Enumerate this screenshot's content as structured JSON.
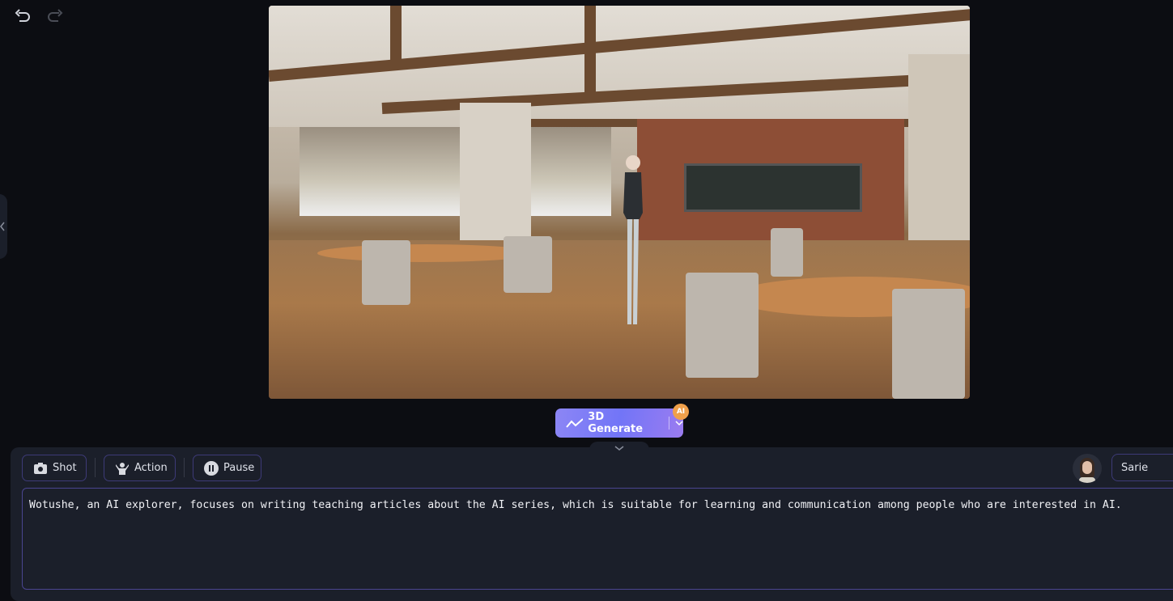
{
  "toolbar_top": {
    "undo_icon": "undo-icon",
    "redo_icon": "redo-icon"
  },
  "generate": {
    "label": "3D Generate",
    "badge": "AI",
    "accent": "#7a78f6"
  },
  "controls": {
    "shot": "Shot",
    "action": "Action",
    "pause": "Pause"
  },
  "character": {
    "name": "Sarie"
  },
  "script_text": "Wotushe, an AI explorer, focuses on writing teaching articles about the AI series, which is suitable for learning and communication among people who are interested in AI."
}
